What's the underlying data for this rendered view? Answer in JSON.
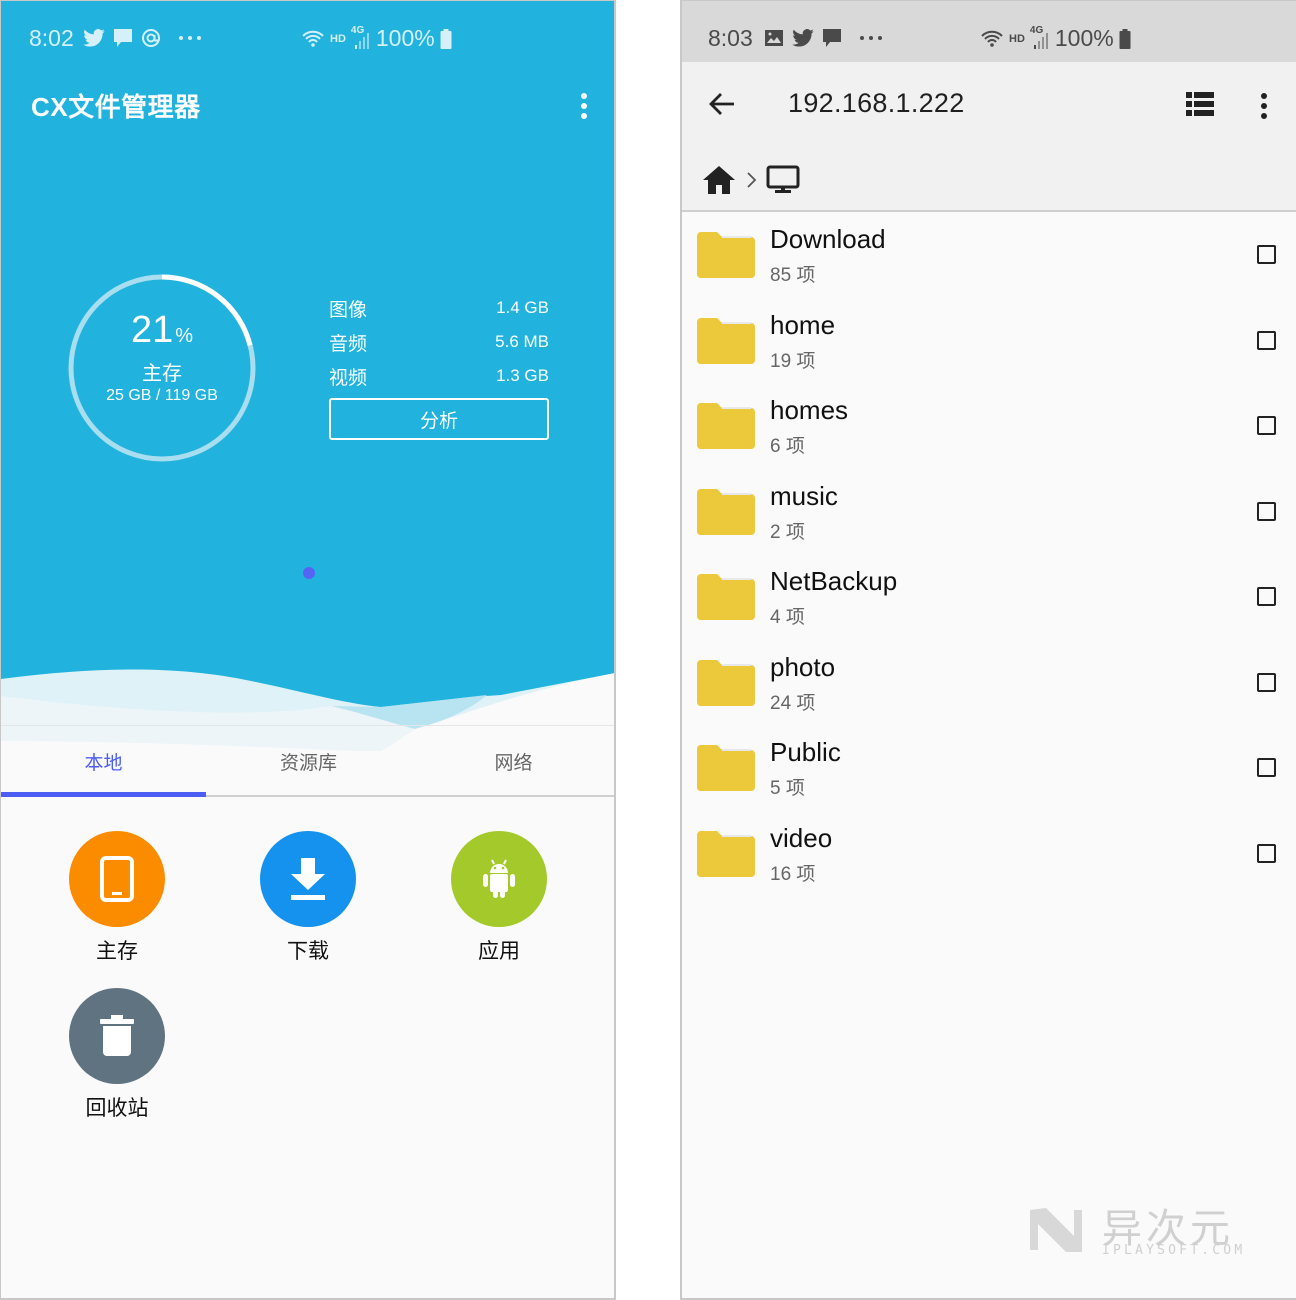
{
  "left": {
    "status_bar": {
      "time": "8:02",
      "notification_icons": [
        "twitter-icon",
        "message-icon",
        "at-sign-icon",
        "more-dots-icon"
      ],
      "system_icons": [
        "wifi-icon",
        "hd-icon",
        "signal-4g-icon",
        "battery-icon"
      ],
      "hd": "HD",
      "network": "4G",
      "battery": "100%"
    },
    "app_title": "CX文件管理器",
    "storage": {
      "percent": 21,
      "percent_label": "21",
      "percent_sign": "%",
      "label": "主存",
      "capacity": "25 GB / 119 GB",
      "used_fraction": 0.21
    },
    "stats": [
      {
        "label": "图像",
        "value": "1.4 GB"
      },
      {
        "label": "音频",
        "value": "5.6 MB"
      },
      {
        "label": "视频",
        "value": "1.3 GB"
      }
    ],
    "analyze_button": "分析",
    "page_indicator": {
      "count": 1,
      "active": 0
    },
    "tabs": [
      {
        "label": "本地",
        "active": true
      },
      {
        "label": "资源库",
        "active": false
      },
      {
        "label": "网络",
        "active": false
      }
    ],
    "shortcuts": [
      {
        "label": "主存",
        "icon": "tablet-icon",
        "color": "#fb8c00"
      },
      {
        "label": "下载",
        "icon": "download-icon",
        "color": "#1592ee"
      },
      {
        "label": "应用",
        "icon": "android-icon",
        "color": "#a4c92a"
      },
      {
        "label": "回收站",
        "icon": "trash-icon",
        "color": "#607380"
      }
    ],
    "colors": {
      "hero": "#21b3dd",
      "accent": "#4d5ef5"
    }
  },
  "right": {
    "status_bar": {
      "time": "8:03",
      "notification_icons": [
        "image-icon",
        "twitter-icon",
        "message-icon",
        "more-dots-icon"
      ],
      "system_icons": [
        "wifi-icon",
        "hd-icon",
        "signal-4g-icon",
        "battery-icon"
      ],
      "hd": "HD",
      "network": "4G",
      "battery": "100%"
    },
    "title": "192.168.1.222",
    "breadcrumb": [
      "home-icon",
      "computer-icon"
    ],
    "folders": [
      {
        "name": "Download",
        "count": "85 项",
        "checked": false
      },
      {
        "name": "home",
        "count": "19 项",
        "checked": false
      },
      {
        "name": "homes",
        "count": "6 项",
        "checked": false
      },
      {
        "name": "music",
        "count": "2 项",
        "checked": false
      },
      {
        "name": "NetBackup",
        "count": "4 项",
        "checked": false
      },
      {
        "name": "photo",
        "count": "24 项",
        "checked": false
      },
      {
        "name": "Public",
        "count": "5 项",
        "checked": false
      },
      {
        "name": "video",
        "count": "16 项",
        "checked": false
      }
    ],
    "colors": {
      "folder": "#ebc93a"
    }
  },
  "watermark": {
    "title": "异次元",
    "subtitle": "IPLAYSOFT.COM"
  }
}
